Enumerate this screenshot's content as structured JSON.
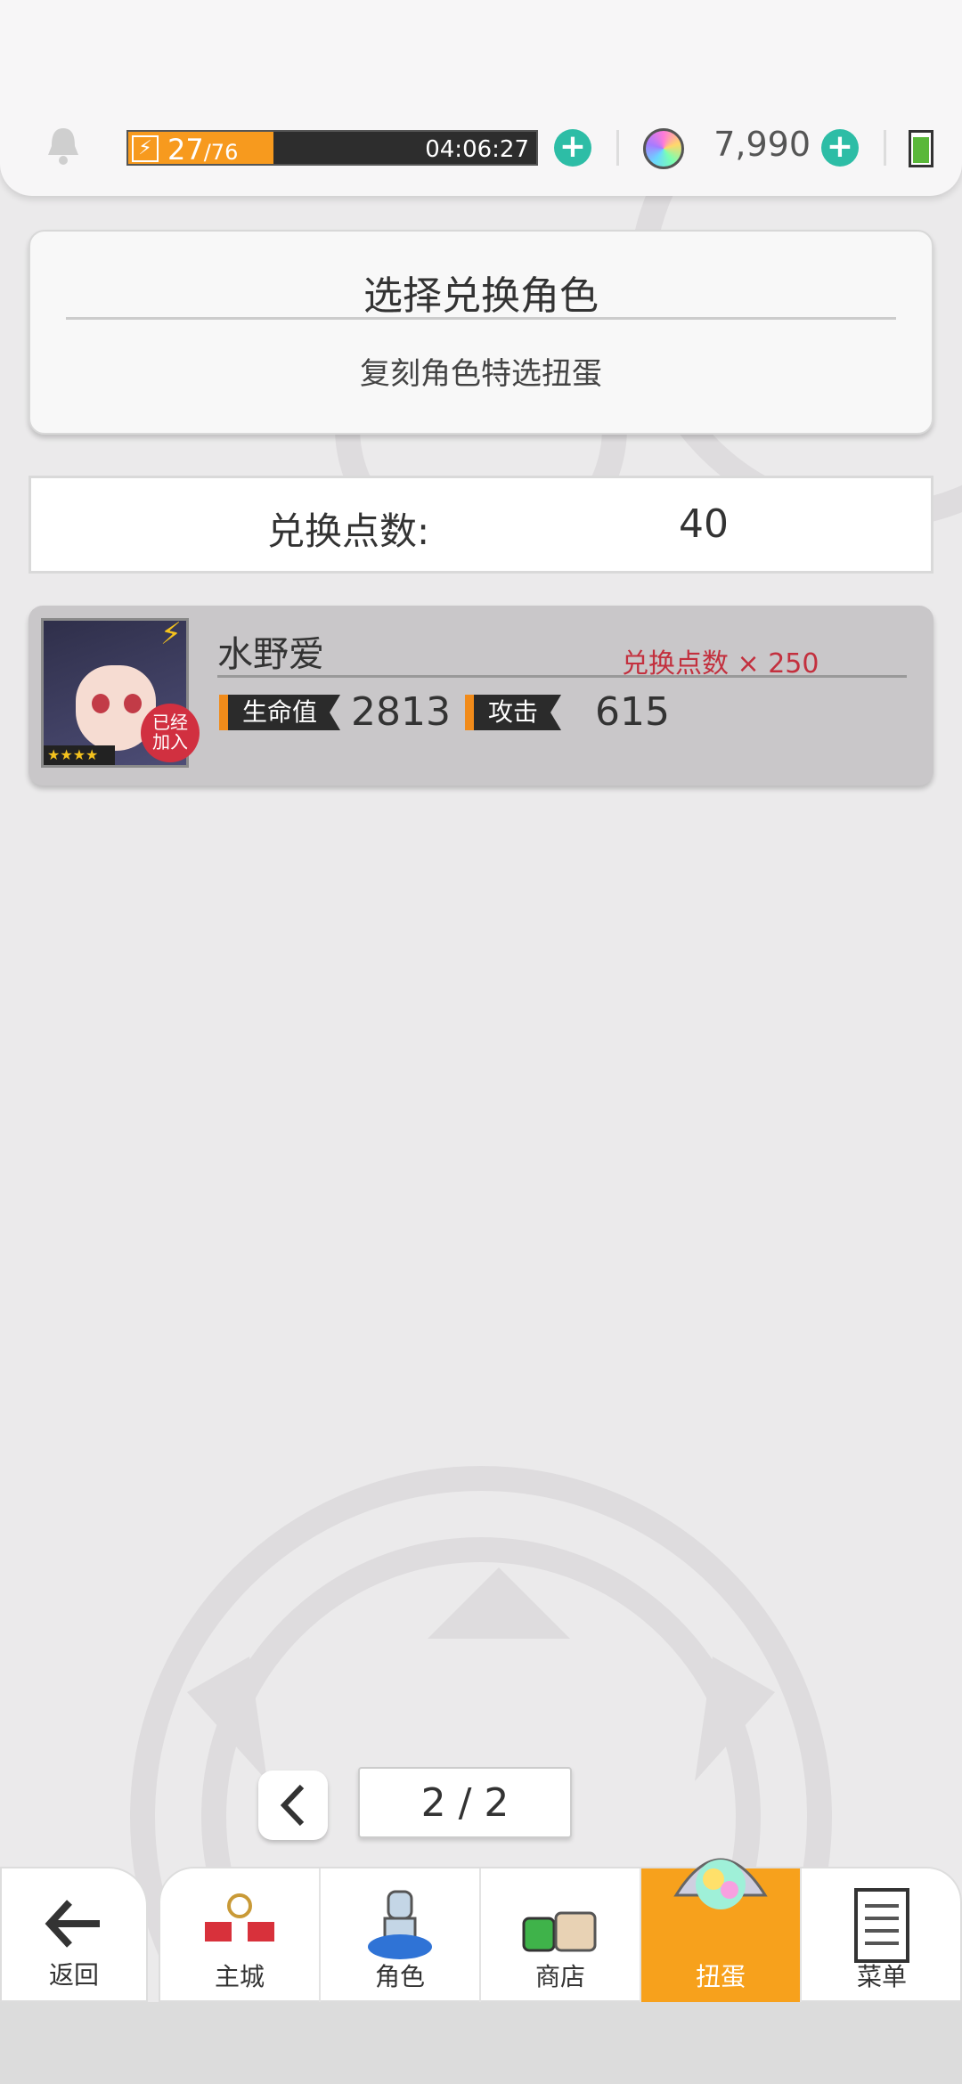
{
  "status_bar": {
    "stamina_current": "27",
    "stamina_max": "/76",
    "stamina_fraction": 0.355,
    "stamina_timer": "04:06:27",
    "gem_count": "7,990"
  },
  "title_card": {
    "title": "选择兑换角色",
    "subtitle": "复刻角色特选扭蛋"
  },
  "points": {
    "label": "兑换点数:",
    "value": "40"
  },
  "characters": [
    {
      "name": "水野爱",
      "cost": "兑换点数 × 250",
      "badge": "已经\n加入",
      "stars": "★★★★",
      "hp_label": "生命值",
      "hp_value": "2813",
      "atk_label": "攻击",
      "atk_value": "615"
    }
  ],
  "pagination": {
    "prev_icon": "chevron-left-icon",
    "indicator": "2 / 2"
  },
  "nav": {
    "back": "返回",
    "items": [
      {
        "label": "主城",
        "icon": "castle-icon"
      },
      {
        "label": "角色",
        "icon": "character-icon"
      },
      {
        "label": "商店",
        "icon": "shop-icon"
      },
      {
        "label": "扭蛋",
        "icon": "gacha-icon",
        "active": true
      },
      {
        "label": "菜单",
        "icon": "menu-icon"
      }
    ]
  },
  "colors": {
    "accent_orange": "#f7a11c",
    "plus_teal": "#2dbda6",
    "cost_red": "#c3303e"
  }
}
